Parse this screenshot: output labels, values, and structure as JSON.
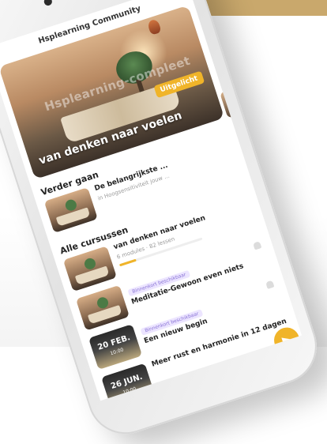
{
  "app": {
    "header_title": "Hsplearning Community"
  },
  "hero": {
    "watermark": "Hsplearning-compleet",
    "badge": "Uitgelicht",
    "title": "van denken naar voelen"
  },
  "continue": {
    "heading": "Verder gaan",
    "item": {
      "title": "De belangrijkste ...",
      "subtitle": "in Hoogsensitiviteit jouw ..."
    }
  },
  "courses": {
    "heading": "Alle cursussen",
    "items": [
      {
        "title": "van denken naar voelen",
        "meta": "6 modules · 82 lessen",
        "progress_percent": 20
      },
      {
        "tag": "Binnenkort beschikbaar",
        "title": "Meditatie-Gewoon even niets"
      },
      {
        "tag": "Binnenkort beschikbaar",
        "title": "Een nieuw begin",
        "date": "20 FEB.",
        "time": "10:00"
      },
      {
        "title": "Meer rust en harmonie in 12 dagen",
        "date": "26 JUN.",
        "time": "10:00"
      }
    ]
  },
  "colors": {
    "accent": "#f0b429",
    "tag_bg": "#ece5ff",
    "tag_text": "#8a74d6"
  },
  "icons": {
    "bell": "bell-icon",
    "fab": "play-icon"
  }
}
